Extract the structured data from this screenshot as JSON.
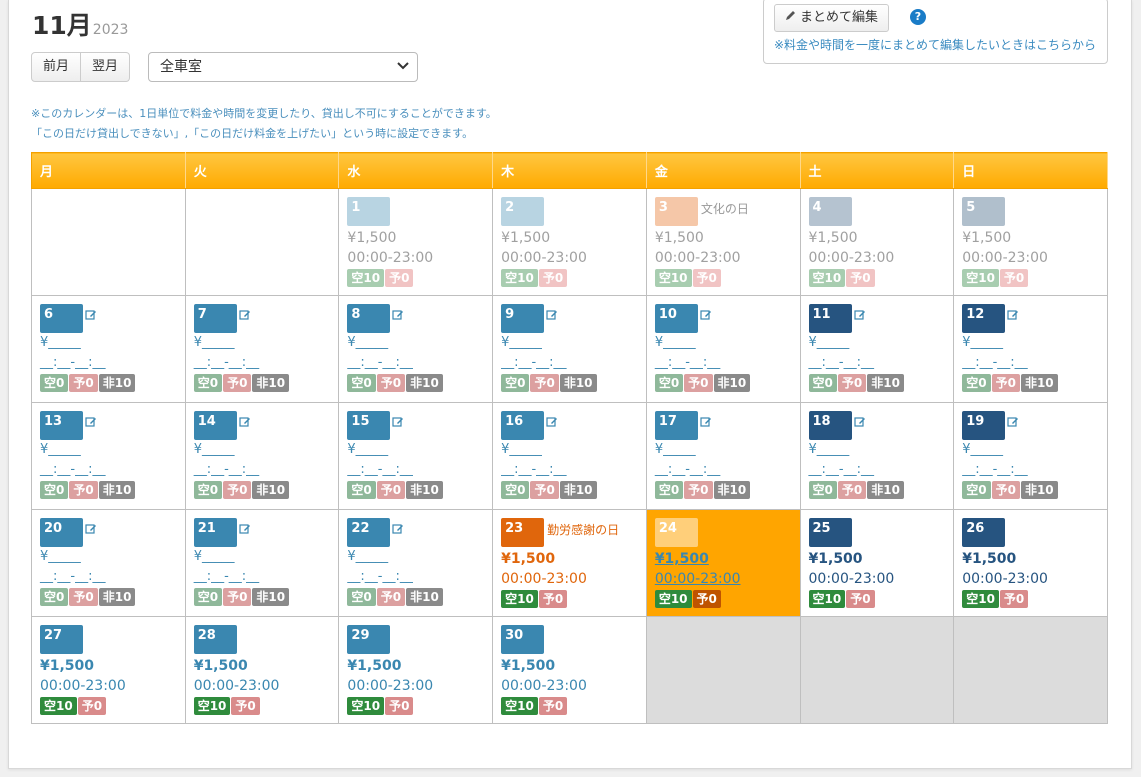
{
  "header": {
    "month": "11月",
    "year": "2023"
  },
  "nav": {
    "prev_label": "前月",
    "next_label": "翌月"
  },
  "room_select": {
    "value": "全車室"
  },
  "bulk": {
    "button_label": "まとめて編集",
    "help": "?",
    "note": "※料金や時間を一度にまとめて編集したいときはこちらから"
  },
  "notes": [
    "※このカレンダーは、1日単位で料金や時間を変更したり、貸出し不可にすることができます。",
    "「この日だけ貸出しできない」,「この日だけ料金を上げたい」という時に設定できます。"
  ],
  "weekdays": [
    "月",
    "火",
    "水",
    "木",
    "金",
    "土",
    "日"
  ],
  "days": {
    "d1": {
      "num": "1",
      "price": "¥1,500",
      "time": "00:00-23:00",
      "ku": "空10",
      "yo": "予0"
    },
    "d2": {
      "num": "2",
      "price": "¥1,500",
      "time": "00:00-23:00",
      "ku": "空10",
      "yo": "予0"
    },
    "d3": {
      "num": "3",
      "holiday": "文化の日",
      "price": "¥1,500",
      "time": "00:00-23:00",
      "ku": "空10",
      "yo": "予0"
    },
    "d4": {
      "num": "4",
      "price": "¥1,500",
      "time": "00:00-23:00",
      "ku": "空10",
      "yo": "予0"
    },
    "d5": {
      "num": "5",
      "price": "¥1,500",
      "time": "00:00-23:00",
      "ku": "空10",
      "yo": "予0"
    },
    "d23": {
      "num": "23",
      "holiday": "勤労感謝の日",
      "price": "¥1,500",
      "time": "00:00-23:00",
      "ku": "空10",
      "yo": "予0"
    },
    "d24": {
      "num": "24",
      "price": "¥1,500",
      "time": "00:00-23:00",
      "ku": "空10",
      "yo": "予0"
    },
    "d25": {
      "num": "25",
      "price": "¥1,500",
      "time": "00:00-23:00",
      "ku": "空10",
      "yo": "予0"
    },
    "d26": {
      "num": "26",
      "price": "¥1,500",
      "time": "00:00-23:00",
      "ku": "空10",
      "yo": "予0"
    },
    "d27": {
      "num": "27",
      "price": "¥1,500",
      "time": "00:00-23:00",
      "ku": "空10",
      "yo": "予0"
    },
    "d28": {
      "num": "28",
      "price": "¥1,500",
      "time": "00:00-23:00",
      "ku": "空10",
      "yo": "予0"
    },
    "d29": {
      "num": "29",
      "price": "¥1,500",
      "time": "00:00-23:00",
      "ku": "空10",
      "yo": "予0"
    },
    "d30": {
      "num": "30",
      "price": "¥1,500",
      "time": "00:00-23:00",
      "ku": "空10",
      "yo": "予0"
    }
  },
  "blank_days": {
    "price": "¥_____",
    "time": "__:__-__:__",
    "ku": "空0",
    "yo": "予0",
    "hi": "非10",
    "nums": [
      "6",
      "7",
      "8",
      "9",
      "10",
      "11",
      "12",
      "13",
      "14",
      "15",
      "16",
      "17",
      "18",
      "19",
      "20",
      "21",
      "22"
    ]
  },
  "colors": {
    "header": "#ffaa00",
    "day_blue": "#3a87b0",
    "day_navy": "#265480",
    "holiday_orange": "#e0660c",
    "today": "#ffa500"
  },
  "icons": {
    "edit": "edit-icon",
    "pencil": "pencil-icon",
    "chevron": "chevron-down-icon"
  }
}
